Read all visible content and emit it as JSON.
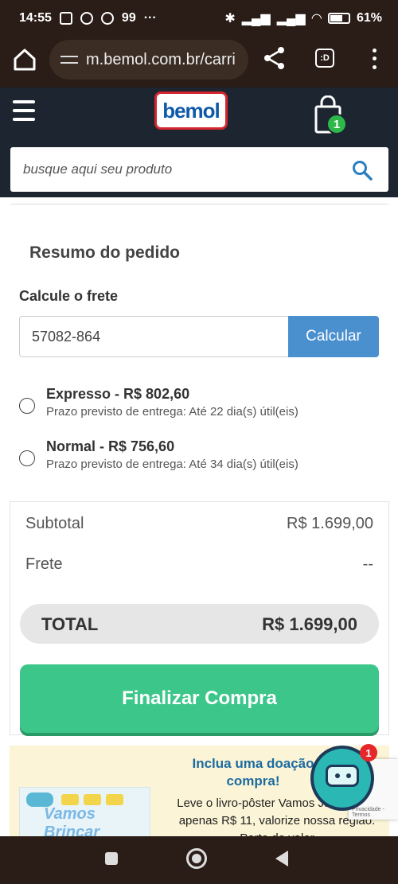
{
  "status_bar": {
    "time": "14:55",
    "notifications": "99",
    "more": "···",
    "battery": "61%"
  },
  "browser": {
    "url": "m.bemol.com.br/carri",
    "tabs_label": ":D"
  },
  "site": {
    "logo_text": "bemol",
    "cart_count": "1",
    "search_placeholder": "busque aqui seu produto"
  },
  "summary": {
    "title": "Resumo do pedido",
    "freight_title": "Calcule o frete",
    "cep_value": "57082-864",
    "calc_button": "Calcular",
    "shipping_options": [
      {
        "name": "Expresso - R$ 802,60",
        "desc": "Prazo previsto de entrega: Até 22 dia(s) útil(eis)"
      },
      {
        "name": "Normal - R$ 756,60",
        "desc": "Prazo previsto de entrega: Até 34 dia(s) útil(eis)"
      }
    ]
  },
  "totals": {
    "subtotal_label": "Subtotal",
    "subtotal_value": "R$ 1.699,00",
    "freight_label": "Frete",
    "freight_value": "--",
    "total_label": "TOTAL",
    "total_value": "R$ 1.699,00",
    "checkout_button": "Finalizar Compra"
  },
  "donation": {
    "title": "Inclua uma doação compra!",
    "text": "Leve o livro-pôster Vamos Juntos! por apenas R$ 11, valorize nossa região. Parte do valor",
    "poster_title": "Vamos Brincar",
    "bot_badge": "1",
    "recaptcha_text": "Privacidade - Termos"
  },
  "colors": {
    "brand_blue": "#0f5aa8",
    "calc_button": "#4a90cf",
    "checkout_green": "#3cc68a",
    "header_dark": "#1c2530"
  }
}
